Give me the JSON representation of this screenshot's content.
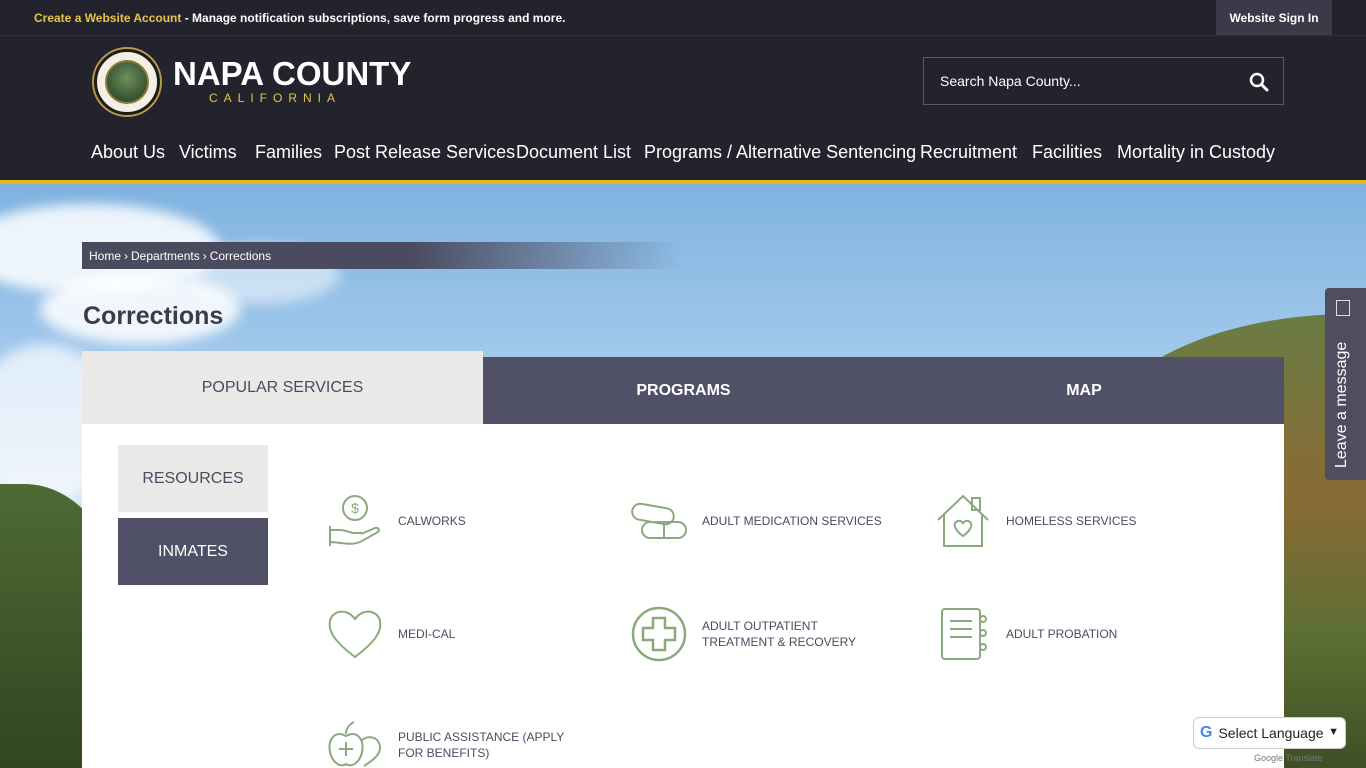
{
  "topbar": {
    "create_link": "Create a Website Account",
    "create_rest": " - Manage notification subscriptions, save form progress and more.",
    "signin": "Website Sign In"
  },
  "logo": {
    "title": "NAPA COUNTY",
    "subtitle": "CALIFORNIA"
  },
  "search": {
    "placeholder": "Search Napa County..."
  },
  "nav": [
    "About Us",
    "Victims",
    "Families",
    "Post Release Services",
    "Document List",
    "Programs / Alternative Sentencing",
    "Recruitment",
    "Facilities",
    "Mortality in Custody"
  ],
  "breadcrumb": [
    "Home",
    "›",
    "Departments",
    "›",
    "Corrections"
  ],
  "page_title": "Corrections",
  "tabs": [
    "POPULAR SERVICES",
    "PROGRAMS",
    "MAP"
  ],
  "side_buttons": [
    "RESOURCES",
    "INMATES"
  ],
  "services": [
    {
      "label": "CALWORKS",
      "icon": "money-hand-icon"
    },
    {
      "label": "ADULT MEDICATION SERVICES",
      "icon": "pill-capsule-icon"
    },
    {
      "label": "HOMELESS SERVICES",
      "icon": "house-heart-icon"
    },
    {
      "label": "MEDI-CAL",
      "icon": "heart-icon"
    },
    {
      "label": "ADULT OUTPATIENT TREATMENT & RECOVERY",
      "icon": "medical-cross-icon"
    },
    {
      "label": "ADULT PROBATION",
      "icon": "notebook-icon"
    },
    {
      "label": "PUBLIC ASSISTANCE (APPLY FOR BENEFITS)",
      "icon": "apple-heart-icon"
    }
  ],
  "feedback": {
    "label": "Leave a message"
  },
  "translate": {
    "label": "Select Language",
    "powered": "Google Translate"
  },
  "colors": {
    "dark": "#23232e",
    "accent_yellow": "#e3b81c",
    "tab_dark": "#505066",
    "icon_green": "#8aaa7d"
  }
}
